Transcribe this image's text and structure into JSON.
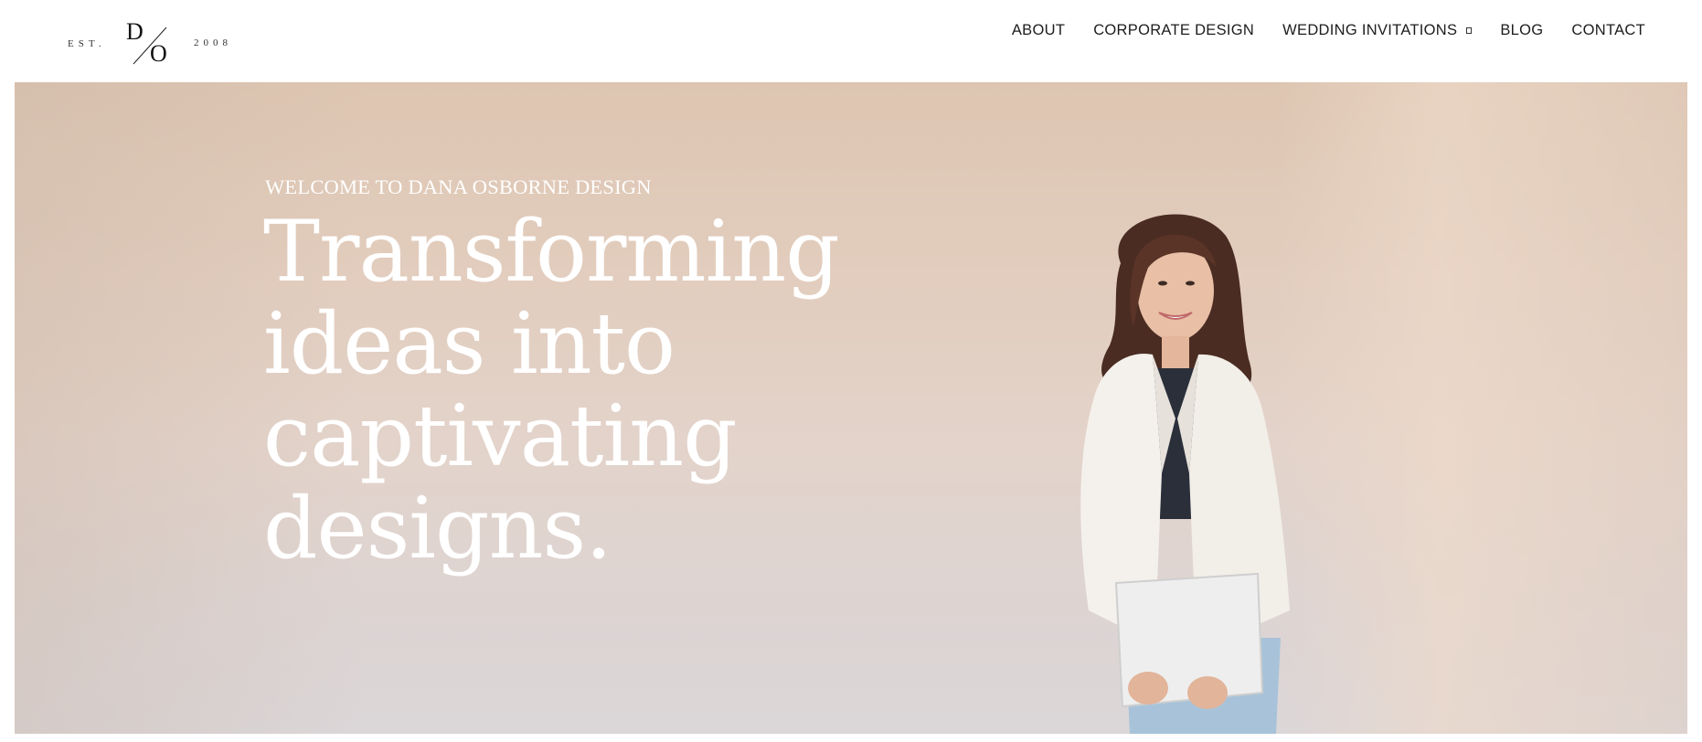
{
  "logo": {
    "est": "EST.",
    "letter_d": "D",
    "letter_o": "O",
    "year": "2008"
  },
  "nav": {
    "items": [
      {
        "label": "ABOUT"
      },
      {
        "label": "CORPORATE DESIGN"
      },
      {
        "label": "WEDDING INVITATIONS",
        "dropdown": true
      },
      {
        "label": "BLOG"
      },
      {
        "label": "CONTACT"
      }
    ]
  },
  "hero": {
    "eyebrow": "WELCOME TO DANA OSBORNE DESIGN",
    "headline_lines": [
      "Transforming",
      "ideas into",
      "captivating",
      "designs."
    ],
    "image": "portrait of smiling woman in white blazer holding a laptop"
  },
  "colors": {
    "hero_top": "#ddc5b1",
    "hero_bottom": "#dbd6d8",
    "nav_text": "#1d1d1d",
    "hero_text": "#ffffff"
  }
}
